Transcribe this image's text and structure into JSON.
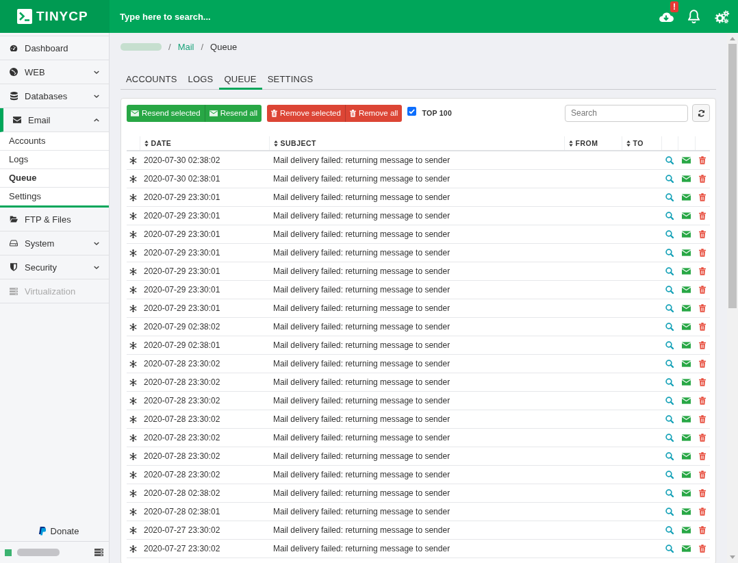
{
  "topbar": {
    "logo": "TINYCP",
    "search": {
      "placeholder": "Type here to search..."
    },
    "update_badge": "!"
  },
  "sidebar": {
    "items": [
      {
        "label": "Dashboard",
        "kind": "link",
        "expanded": false,
        "disabled": false
      },
      {
        "label": "WEB",
        "kind": "menu",
        "expanded": false,
        "disabled": false
      },
      {
        "label": "Databases",
        "kind": "menu",
        "expanded": false,
        "disabled": false
      },
      {
        "label": "Email",
        "kind": "menu",
        "expanded": true,
        "disabled": false,
        "children": [
          {
            "label": "Accounts",
            "selected": false
          },
          {
            "label": "Logs",
            "selected": false
          },
          {
            "label": "Queue",
            "selected": true
          },
          {
            "label": "Settings",
            "selected": false
          }
        ]
      },
      {
        "label": "FTP & Files",
        "kind": "link",
        "expanded": false,
        "disabled": false
      },
      {
        "label": "System",
        "kind": "menu",
        "expanded": false,
        "disabled": false
      },
      {
        "label": "Security",
        "kind": "menu",
        "expanded": false,
        "disabled": false
      },
      {
        "label": "Virtualization",
        "kind": "link",
        "expanded": false,
        "disabled": true
      }
    ],
    "donate": "Donate"
  },
  "breadcrumb": {
    "separator": "/",
    "items": [
      {
        "kind": "redacted"
      },
      {
        "kind": "link",
        "label": "Mail"
      },
      {
        "kind": "current",
        "label": "Queue"
      }
    ]
  },
  "tabs": [
    {
      "label": "ACCOUNTS",
      "selected": false
    },
    {
      "label": "LOGS",
      "selected": false
    },
    {
      "label": "QUEUE",
      "selected": true
    },
    {
      "label": "SETTINGS",
      "selected": false
    }
  ],
  "toolbar": {
    "button_groups": [
      {
        "kind": "resend",
        "buttons": [
          "Resend selected",
          "Resend all"
        ]
      },
      {
        "kind": "remove",
        "buttons": [
          "Remove selected",
          "Remove all"
        ]
      }
    ],
    "top_filter": {
      "label": "TOP 100",
      "checked": true
    },
    "search": {
      "placeholder": "Search"
    }
  },
  "table": {
    "columns": [
      "DATE",
      "SUBJECT",
      "FROM",
      "TO"
    ],
    "rows": [
      {
        "date": "2020-07-30 02:38:02",
        "subject": "Mail delivery failed: returning message to sender"
      },
      {
        "date": "2020-07-30 02:38:01",
        "subject": "Mail delivery failed: returning message to sender"
      },
      {
        "date": "2020-07-29 23:30:01",
        "subject": "Mail delivery failed: returning message to sender"
      },
      {
        "date": "2020-07-29 23:30:01",
        "subject": "Mail delivery failed: returning message to sender"
      },
      {
        "date": "2020-07-29 23:30:01",
        "subject": "Mail delivery failed: returning message to sender"
      },
      {
        "date": "2020-07-29 23:30:01",
        "subject": "Mail delivery failed: returning message to sender"
      },
      {
        "date": "2020-07-29 23:30:01",
        "subject": "Mail delivery failed: returning message to sender"
      },
      {
        "date": "2020-07-29 23:30:01",
        "subject": "Mail delivery failed: returning message to sender"
      },
      {
        "date": "2020-07-29 23:30:01",
        "subject": "Mail delivery failed: returning message to sender"
      },
      {
        "date": "2020-07-29 02:38:02",
        "subject": "Mail delivery failed: returning message to sender"
      },
      {
        "date": "2020-07-29 02:38:01",
        "subject": "Mail delivery failed: returning message to sender"
      },
      {
        "date": "2020-07-28 23:30:02",
        "subject": "Mail delivery failed: returning message to sender"
      },
      {
        "date": "2020-07-28 23:30:02",
        "subject": "Mail delivery failed: returning message to sender"
      },
      {
        "date": "2020-07-28 23:30:02",
        "subject": "Mail delivery failed: returning message to sender"
      },
      {
        "date": "2020-07-28 23:30:02",
        "subject": "Mail delivery failed: returning message to sender"
      },
      {
        "date": "2020-07-28 23:30:02",
        "subject": "Mail delivery failed: returning message to sender"
      },
      {
        "date": "2020-07-28 23:30:02",
        "subject": "Mail delivery failed: returning message to sender"
      },
      {
        "date": "2020-07-28 23:30:02",
        "subject": "Mail delivery failed: returning message to sender"
      },
      {
        "date": "2020-07-28 02:38:02",
        "subject": "Mail delivery failed: returning message to sender"
      },
      {
        "date": "2020-07-28 02:38:01",
        "subject": "Mail delivery failed: returning message to sender"
      },
      {
        "date": "2020-07-27 23:30:02",
        "subject": "Mail delivery failed: returning message to sender"
      },
      {
        "date": "2020-07-27 23:30:02",
        "subject": "Mail delivery failed: returning message to sender"
      }
    ]
  }
}
